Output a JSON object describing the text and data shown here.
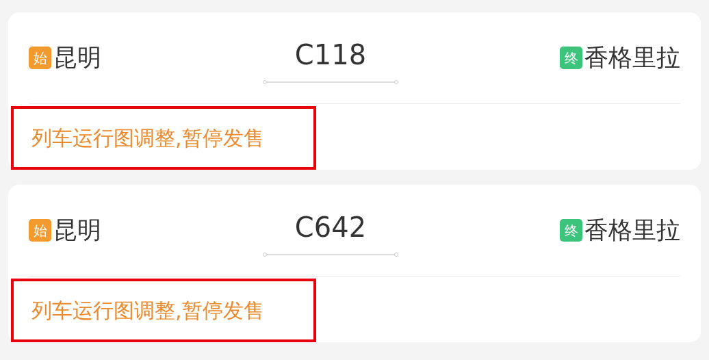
{
  "trains": [
    {
      "from": {
        "badge": "始",
        "color": "#f29a2e",
        "name": "昆明"
      },
      "number": "C118",
      "to": {
        "badge": "终",
        "color": "#3cc47c",
        "name": "香格里拉"
      },
      "notice": "列车运行图调整,暂停发售",
      "highlighted": true
    },
    {
      "from": {
        "badge": "始",
        "color": "#f29a2e",
        "name": "昆明"
      },
      "number": "C642",
      "to": {
        "badge": "终",
        "color": "#3cc47c",
        "name": "香格里拉"
      },
      "notice": "列车运行图调整,暂停发售",
      "highlighted": true
    }
  ]
}
